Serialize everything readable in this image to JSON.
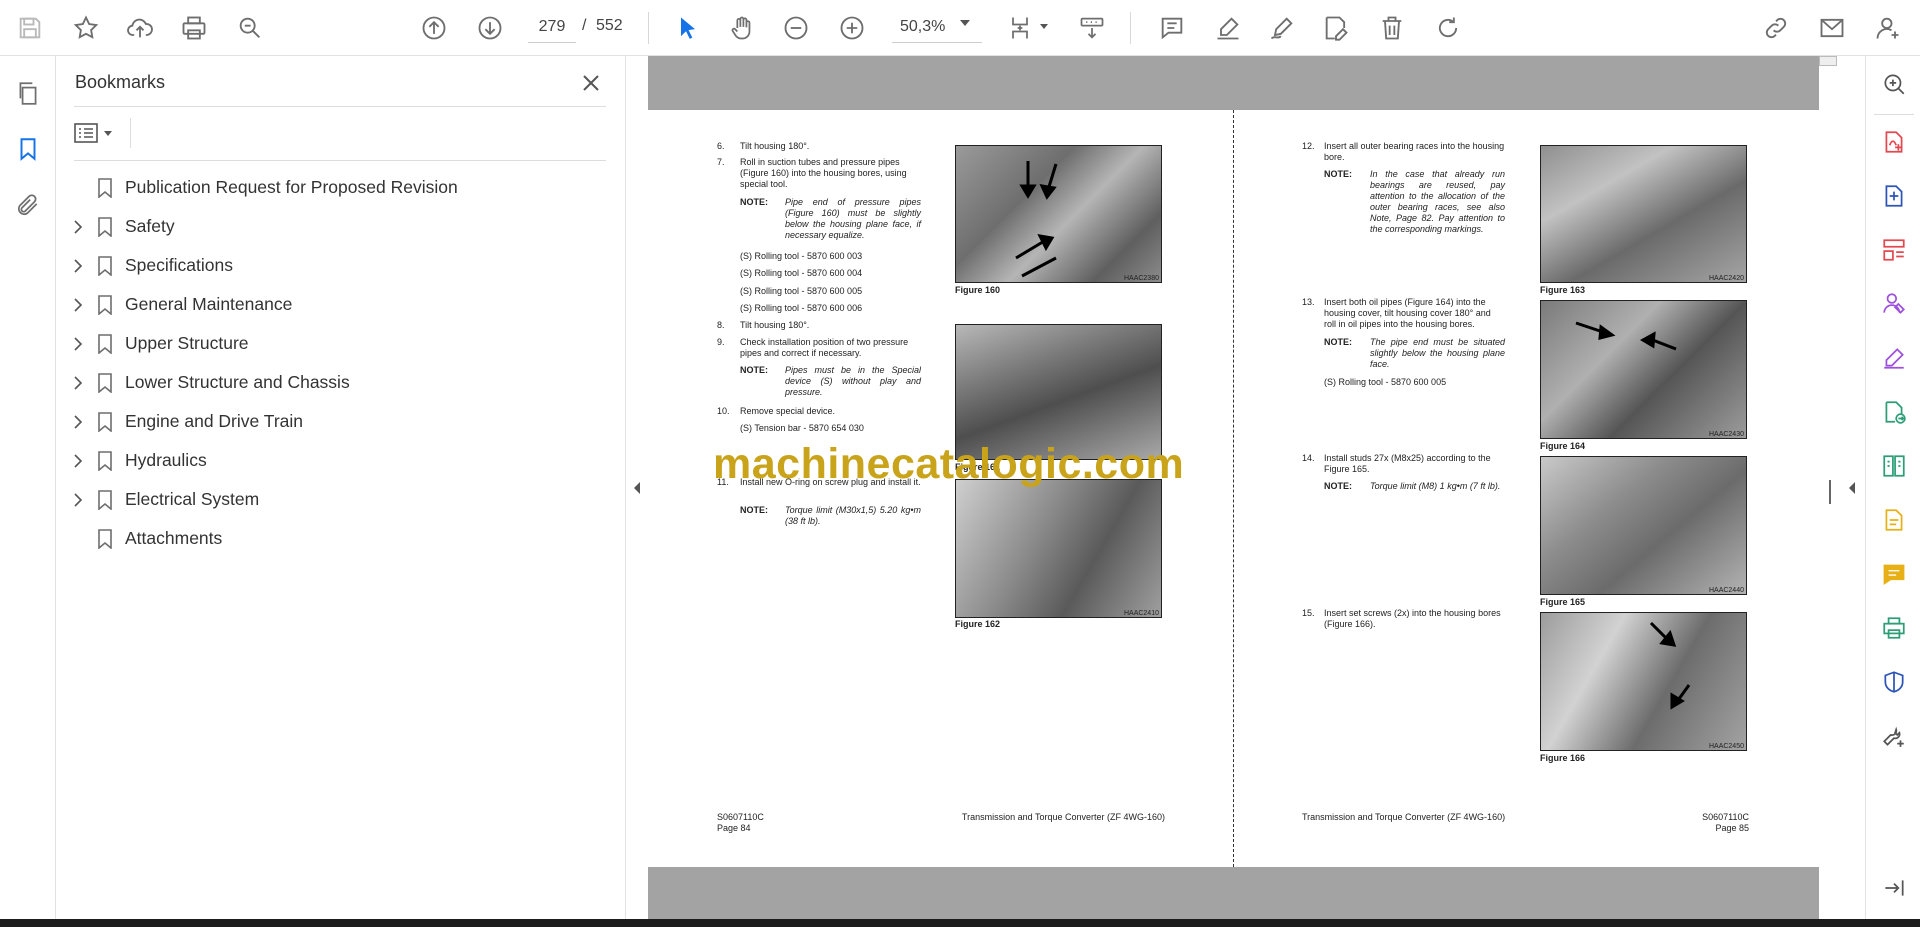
{
  "toolbar": {
    "page_current": "279",
    "page_separator": "/",
    "page_total": "552",
    "zoom": "50,3%"
  },
  "bookmarks": {
    "title": "Bookmarks",
    "items": [
      {
        "label": "Publication Request for Proposed Revision",
        "expandable": false
      },
      {
        "label": "Safety",
        "expandable": true
      },
      {
        "label": "Specifications",
        "expandable": true
      },
      {
        "label": "General Maintenance",
        "expandable": true
      },
      {
        "label": "Upper Structure",
        "expandable": true
      },
      {
        "label": "Lower Structure and Chassis",
        "expandable": true
      },
      {
        "label": "Engine and Drive Train",
        "expandable": true
      },
      {
        "label": "Hydraulics",
        "expandable": true
      },
      {
        "label": "Electrical System",
        "expandable": true
      },
      {
        "label": "Attachments",
        "expandable": false
      }
    ]
  },
  "document": {
    "watermark": "machinecatalogic.com",
    "left_page": {
      "steps": [
        {
          "num": "6.",
          "text": "Tilt housing 180°."
        },
        {
          "num": "7.",
          "text": "Roll in suction tubes and pressure pipes (Figure 160) into the housing bores, using special tool."
        },
        {
          "num": "8.",
          "text": "Tilt housing 180°."
        },
        {
          "num": "9.",
          "text": "Check installation position of two pressure pipes and correct if necessary."
        },
        {
          "num": "10.",
          "text": "Remove special device."
        },
        {
          "num": "11.",
          "text": "Install new O-ring on screw plug and install it."
        }
      ],
      "note_label": "NOTE:",
      "notes": [
        "Pipe end of pressure pipes (Figure 160) must be slightly below the housing plane face, if necessary equalize.",
        "Pipes must be in the Special device (S) without play and pressure.",
        "Torque limit (M30x1,5) 5.20 kg•m (38 ft lb)."
      ],
      "tools": [
        "(S) Rolling tool - 5870 600 003",
        "(S) Rolling tool - 5870 600 004",
        "(S) Rolling tool - 5870 600 005",
        "(S) Rolling tool - 5870 600 006",
        "(S) Tension bar - 5870 654 030"
      ],
      "figures": [
        {
          "caption": "Figure 160",
          "code": "HAAC2380"
        },
        {
          "caption": "Figure 161",
          "code": ""
        },
        {
          "caption": "Figure 162",
          "code": "HAAC2410"
        }
      ],
      "footer_code": "S0607110C",
      "footer_page": "Page 84",
      "footer_title": "Transmission and Torque Converter (ZF 4WG-160)"
    },
    "right_page": {
      "steps": [
        {
          "num": "12.",
          "text": "Insert all outer bearing races into the housing bore."
        },
        {
          "num": "13.",
          "text": "Insert both oil pipes (Figure 164) into the housing cover, tilt housing cover 180° and roll in oil pipes into the housing bores."
        },
        {
          "num": "14.",
          "text": "Install studs 27x (M8x25) according to the Figure 165."
        },
        {
          "num": "15.",
          "text": "Insert set screws (2x) into the housing bores (Figure 166)."
        }
      ],
      "note_label": "NOTE:",
      "notes": [
        "In the case that already run bearings are reused, pay attention to the allocation of the outer bearing races, see also Note, Page 82. Pay attention to the corresponding markings.",
        "The pipe end must be situated slightly below the housing plane face.",
        "Torque limit (M8) 1 kg•m (7 ft lb)."
      ],
      "tools": [
        "(S) Rolling tool - 5870 600 005"
      ],
      "figures": [
        {
          "caption": "Figure 163",
          "code": "HAAC2420"
        },
        {
          "caption": "Figure 164",
          "code": "HAAC2430"
        },
        {
          "caption": "Figure 165",
          "code": "HAAC2440"
        },
        {
          "caption": "Figure 166",
          "code": "HAAC2450"
        }
      ],
      "footer_code": "S0607110C",
      "footer_page": "Page 85",
      "footer_title": "Transmission and Torque Converter (ZF 4WG-160)"
    }
  },
  "colors": {
    "accent_blue": "#1473e6",
    "icon_gray": "#6e6e6e",
    "pink": "#e34850",
    "purple": "#9d50dd",
    "teal": "#2d9d78",
    "yellow": "#e8b017",
    "dark_blue": "#2c54b7",
    "watermark": "#c9a41a"
  }
}
